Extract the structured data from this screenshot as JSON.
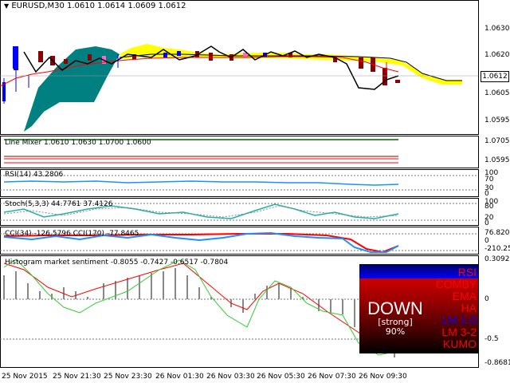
{
  "symbol_header": "EURUSD,M30  1.0610 1.0614 1.0609 1.0612",
  "current_price_tag": "1.0612",
  "price_axis": [
    "1.0630",
    "1.0620",
    "1.0610",
    "1.0605",
    "1.0595"
  ],
  "line_mixer": {
    "title": "Line Mixer 1.0610 1.0630 1.0700 1.0600",
    "axis": [
      "1.0705",
      "1.0595"
    ]
  },
  "rsi": {
    "title": "RSI(14) 43.2806",
    "axis": [
      "100",
      "70",
      "30",
      "0"
    ]
  },
  "stoch": {
    "title": "Stoch(5,3,3) 44.7761 37.4126",
    "axis": [
      "100",
      "80",
      "20",
      "0"
    ]
  },
  "cci": {
    "title": "CCI(34) -126.5796  CCI(170) -77.8465",
    "axis": [
      "76.8201",
      "0",
      "-210.254"
    ]
  },
  "histogram": {
    "title": "Histogram market sentiment -0.8055 -0.7427 -0.6517 -0.7804",
    "axis": [
      "0.3092",
      "0",
      "-0.5",
      "-0.8681"
    ]
  },
  "sentiment_panel": {
    "direction": "DOWN",
    "strength": "[strong]",
    "percent": "90%",
    "indicators": [
      {
        "name": "RSI",
        "color": "#ff0000"
      },
      {
        "name": "COMBY",
        "color": "#ff0000"
      },
      {
        "name": "EMA",
        "color": "#ff0000"
      },
      {
        "name": "HA",
        "color": "#ff0000"
      },
      {
        "name": "LM 1-0",
        "color": "#0000ff"
      },
      {
        "name": "LM 3-2",
        "color": "#ff0000"
      },
      {
        "name": "KUMO",
        "color": "#ff0000"
      }
    ]
  },
  "time_axis": [
    "25 Nov 2015",
    "25 Nov 21:30",
    "25 Nov 23:30",
    "26 Nov 01:30",
    "26 Nov 03:30",
    "26 Nov 05:30",
    "26 Nov 07:30",
    "26 Nov 09:30"
  ],
  "colors": {
    "bull_candle": "#0000ff",
    "bear_candle": "#8b0000",
    "kumo_teal": "#008080",
    "kumo_yellow": "#ffff00",
    "rsi_line": "#1e90ff",
    "stoch_main": "#20b2aa",
    "cci_fast": "#ff0000",
    "cci_slow": "#1e90ff",
    "hist_line_red": "#ff0000",
    "hist_line_green": "#32cd32"
  }
}
